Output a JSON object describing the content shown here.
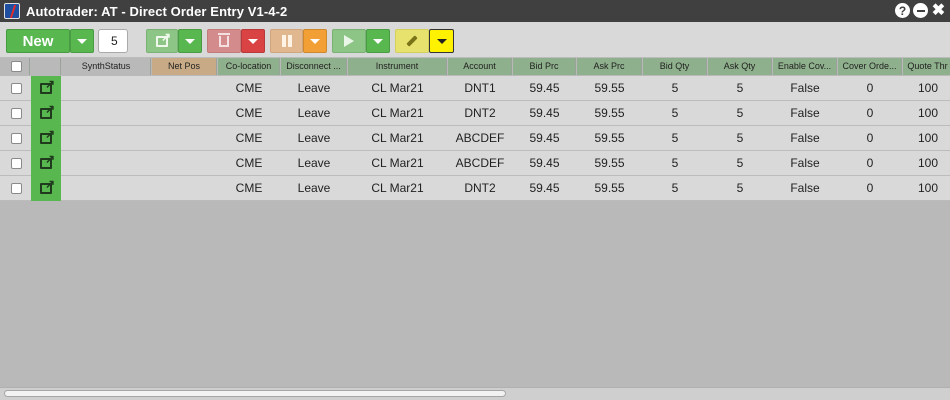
{
  "window": {
    "title": "Autotrader: AT - Direct Order Entry V1-4-2",
    "controls": [
      "help",
      "minimize",
      "close"
    ]
  },
  "toolbar": {
    "new_label": "New",
    "quantity_value": "5",
    "buttons": [
      {
        "name": "launch",
        "icon": "launch-icon",
        "color": "#8cc585"
      },
      {
        "name": "delete",
        "icon": "trash-icon",
        "color": "#d48b8b"
      },
      {
        "name": "pause",
        "icon": "pause-icon",
        "color": "#e0b78e"
      },
      {
        "name": "play",
        "icon": "play-icon",
        "color": "#8cc585"
      },
      {
        "name": "edit",
        "icon": "pencil-icon",
        "color": "#e6e26d"
      }
    ]
  },
  "grid": {
    "columns": [
      {
        "key": "select",
        "label": "",
        "color": "#b9b9b9"
      },
      {
        "key": "launch",
        "label": "",
        "color": "#b9b9b9"
      },
      {
        "key": "synth_status",
        "label": "SynthStatus",
        "color": "#b9b9b9"
      },
      {
        "key": "net_pos",
        "label": "Net Pos",
        "color": "#c8ab86"
      },
      {
        "key": "co_location",
        "label": "Co-location",
        "color": "#8fb08c"
      },
      {
        "key": "disconnect",
        "label": "Disconnect ...",
        "color": "#8fb08c"
      },
      {
        "key": "instrument",
        "label": "Instrument",
        "color": "#8fb08c"
      },
      {
        "key": "account",
        "label": "Account",
        "color": "#8fb08c"
      },
      {
        "key": "bid_prc",
        "label": "Bid Prc",
        "color": "#8fb08c"
      },
      {
        "key": "ask_prc",
        "label": "Ask Prc",
        "color": "#8fb08c"
      },
      {
        "key": "bid_qty",
        "label": "Bid Qty",
        "color": "#8fb08c"
      },
      {
        "key": "ask_qty",
        "label": "Ask Qty",
        "color": "#8fb08c"
      },
      {
        "key": "enable_cover",
        "label": "Enable Cov...",
        "color": "#8fb08c"
      },
      {
        "key": "cover_order",
        "label": "Cover Orde...",
        "color": "#8fb08c"
      },
      {
        "key": "quote_thr",
        "label": "Quote Thr",
        "color": "#8fb08c"
      }
    ],
    "rows": [
      {
        "synth_status": "",
        "net_pos": "",
        "co_location": "CME",
        "disconnect": "Leave",
        "instrument": "CL Mar21",
        "account": "DNT1",
        "bid_prc": "59.45",
        "ask_prc": "59.55",
        "bid_qty": "5",
        "ask_qty": "5",
        "enable_cover": "False",
        "cover_order": "0",
        "quote_thr": "100"
      },
      {
        "synth_status": "",
        "net_pos": "",
        "co_location": "CME",
        "disconnect": "Leave",
        "instrument": "CL Mar21",
        "account": "DNT2",
        "bid_prc": "59.45",
        "ask_prc": "59.55",
        "bid_qty": "5",
        "ask_qty": "5",
        "enable_cover": "False",
        "cover_order": "0",
        "quote_thr": "100"
      },
      {
        "synth_status": "",
        "net_pos": "",
        "co_location": "CME",
        "disconnect": "Leave",
        "instrument": "CL Mar21",
        "account": "ABCDEF",
        "bid_prc": "59.45",
        "ask_prc": "59.55",
        "bid_qty": "5",
        "ask_qty": "5",
        "enable_cover": "False",
        "cover_order": "0",
        "quote_thr": "100"
      },
      {
        "synth_status": "",
        "net_pos": "",
        "co_location": "CME",
        "disconnect": "Leave",
        "instrument": "CL Mar21",
        "account": "ABCDEF",
        "bid_prc": "59.45",
        "ask_prc": "59.55",
        "bid_qty": "5",
        "ask_qty": "5",
        "enable_cover": "False",
        "cover_order": "0",
        "quote_thr": "100"
      },
      {
        "synth_status": "",
        "net_pos": "",
        "co_location": "CME",
        "disconnect": "Leave",
        "instrument": "CL Mar21",
        "account": "DNT2",
        "bid_prc": "59.45",
        "ask_prc": "59.55",
        "bid_qty": "5",
        "ask_qty": "5",
        "enable_cover": "False",
        "cover_order": "0",
        "quote_thr": "100"
      }
    ]
  }
}
